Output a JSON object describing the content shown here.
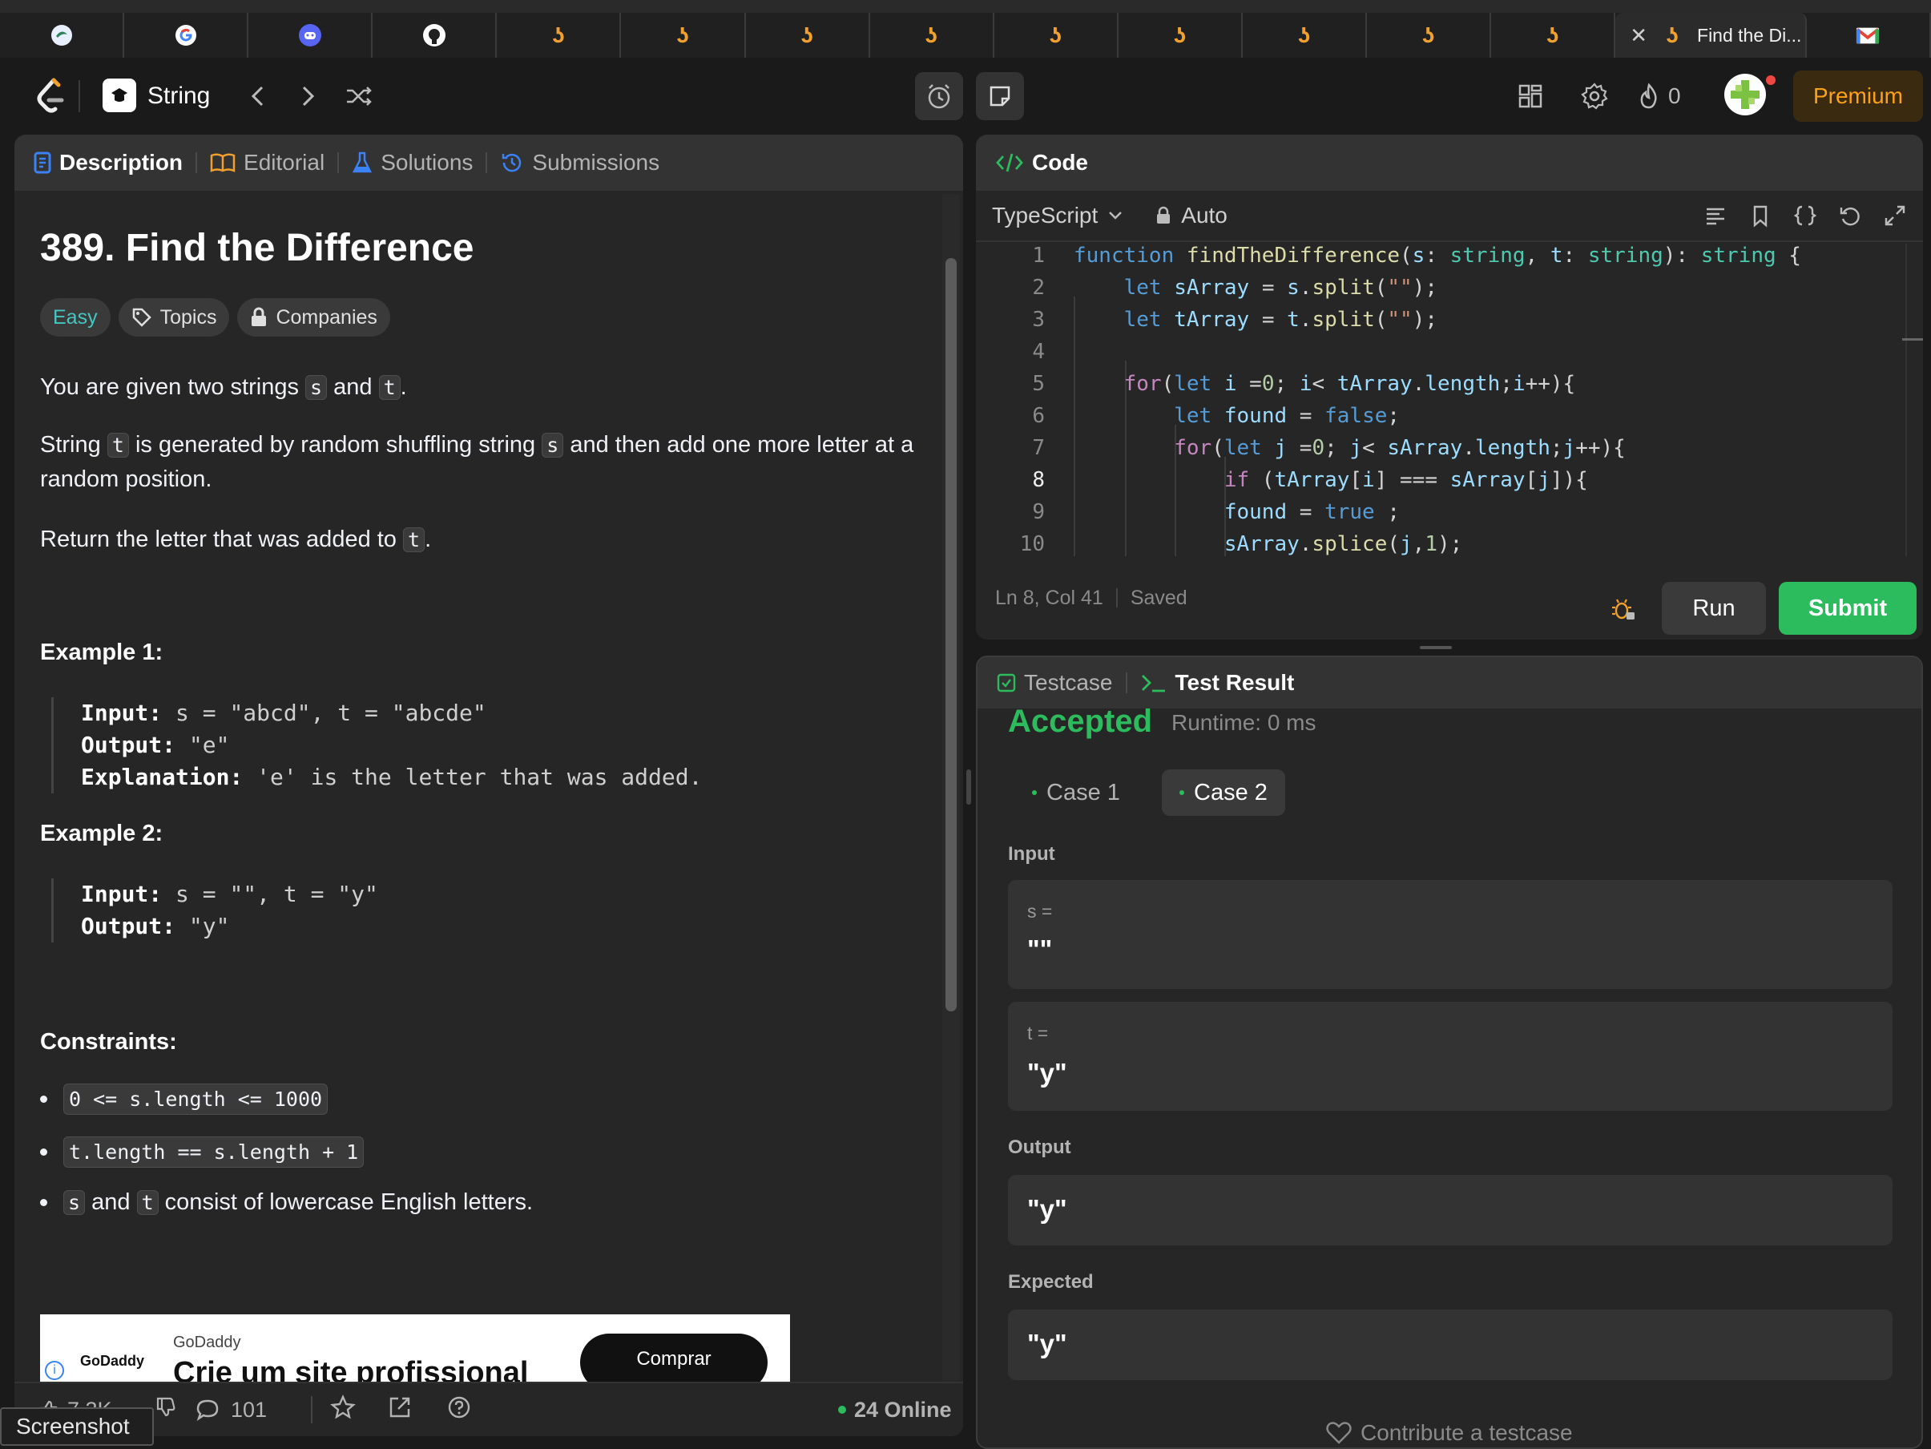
{
  "browser": {
    "active_tab_title": "Find the Di...",
    "close_glyph": "✕",
    "tabs": [
      {
        "icon": "copilot-icon"
      },
      {
        "icon": "google-icon"
      },
      {
        "icon": "discord-icon"
      },
      {
        "icon": "github-icon"
      },
      {
        "icon": "leetcode-icon"
      },
      {
        "icon": "leetcode-icon"
      },
      {
        "icon": "leetcode-icon"
      },
      {
        "icon": "leetcode-icon"
      },
      {
        "icon": "leetcode-icon"
      },
      {
        "icon": "leetcode-icon"
      },
      {
        "icon": "leetcode-icon"
      },
      {
        "icon": "leetcode-icon"
      },
      {
        "icon": "leetcode-icon"
      }
    ],
    "gmail_icon": "gmail-icon"
  },
  "nav": {
    "problem_list_title": "String",
    "streak_count": "0",
    "premium_label": "Premium"
  },
  "left_panel": {
    "tabs": {
      "description": "Description",
      "editorial": "Editorial",
      "solutions": "Solutions",
      "submissions": "Submissions"
    },
    "title": "389. Find the Difference",
    "difficulty": "Easy",
    "topics": "Topics",
    "companies": "Companies",
    "p1": {
      "a": "You are given two strings ",
      "s": "s",
      "b": " and ",
      "t": "t",
      "c": "."
    },
    "p2": {
      "a": "String ",
      "t": "t",
      "b": " is generated by random shuffling string ",
      "s": "s",
      "c": " and then add one more letter at a random position."
    },
    "p3": {
      "a": "Return the letter that was added to ",
      "t": "t",
      "c": "."
    },
    "example1": {
      "heading": "Example 1:",
      "input_label": "Input:",
      "input": " s = \"abcd\", t = \"abcde\"",
      "output_label": "Output:",
      "output": " \"e\"",
      "explanation_label": "Explanation:",
      "explanation": " 'e' is the letter that was added."
    },
    "example2": {
      "heading": "Example 2:",
      "input_label": "Input:",
      "input": " s = \"\", t = \"y\"",
      "output_label": "Output:",
      "output": " \"y\""
    },
    "constraints_heading": "Constraints:",
    "constraints": [
      "0 <= s.length <= 1000",
      "t.length == s.length + 1"
    ],
    "constraint3": {
      "s": "s",
      "a": " and ",
      "t": "t",
      "b": " consist of lowercase English letters."
    },
    "ad": {
      "brand": "GoDaddy",
      "logo_text": "GoDaddy",
      "headline": "Crie um site profissional",
      "button": "Comprar",
      "info_glyph": "i"
    },
    "footer": {
      "likes": "7.3K",
      "comments": "101",
      "online": "24 Online"
    }
  },
  "code_panel": {
    "title": "Code",
    "language": "TypeScript",
    "mode": "Auto",
    "status_position": "Ln 8, Col 41",
    "status_saved": "Saved",
    "run_label": "Run",
    "submit_label": "Submit",
    "line_numbers": [
      "1",
      "2",
      "3",
      "4",
      "5",
      "6",
      "7",
      "8",
      "9",
      "10"
    ],
    "current_line": 8
  },
  "test_panel": {
    "tab_testcase": "Testcase",
    "tab_result": "Test Result",
    "status": "Accepted",
    "runtime": "Runtime: 0 ms",
    "cases": [
      "Case 1",
      "Case 2"
    ],
    "input_label": "Input",
    "s_label": "s =",
    "s_value": "\"\"",
    "t_label": "t =",
    "t_value": "\"y\"",
    "output_label": "Output",
    "output_value": "\"y\"",
    "expected_label": "Expected",
    "expected_value": "\"y\"",
    "contribute": "Contribute a testcase"
  },
  "overlay": {
    "screenshot_label": "Screenshot"
  },
  "colors": {
    "accepted": "#2cbb5d",
    "easy": "#46c6c2",
    "premium": "#ffa116"
  }
}
